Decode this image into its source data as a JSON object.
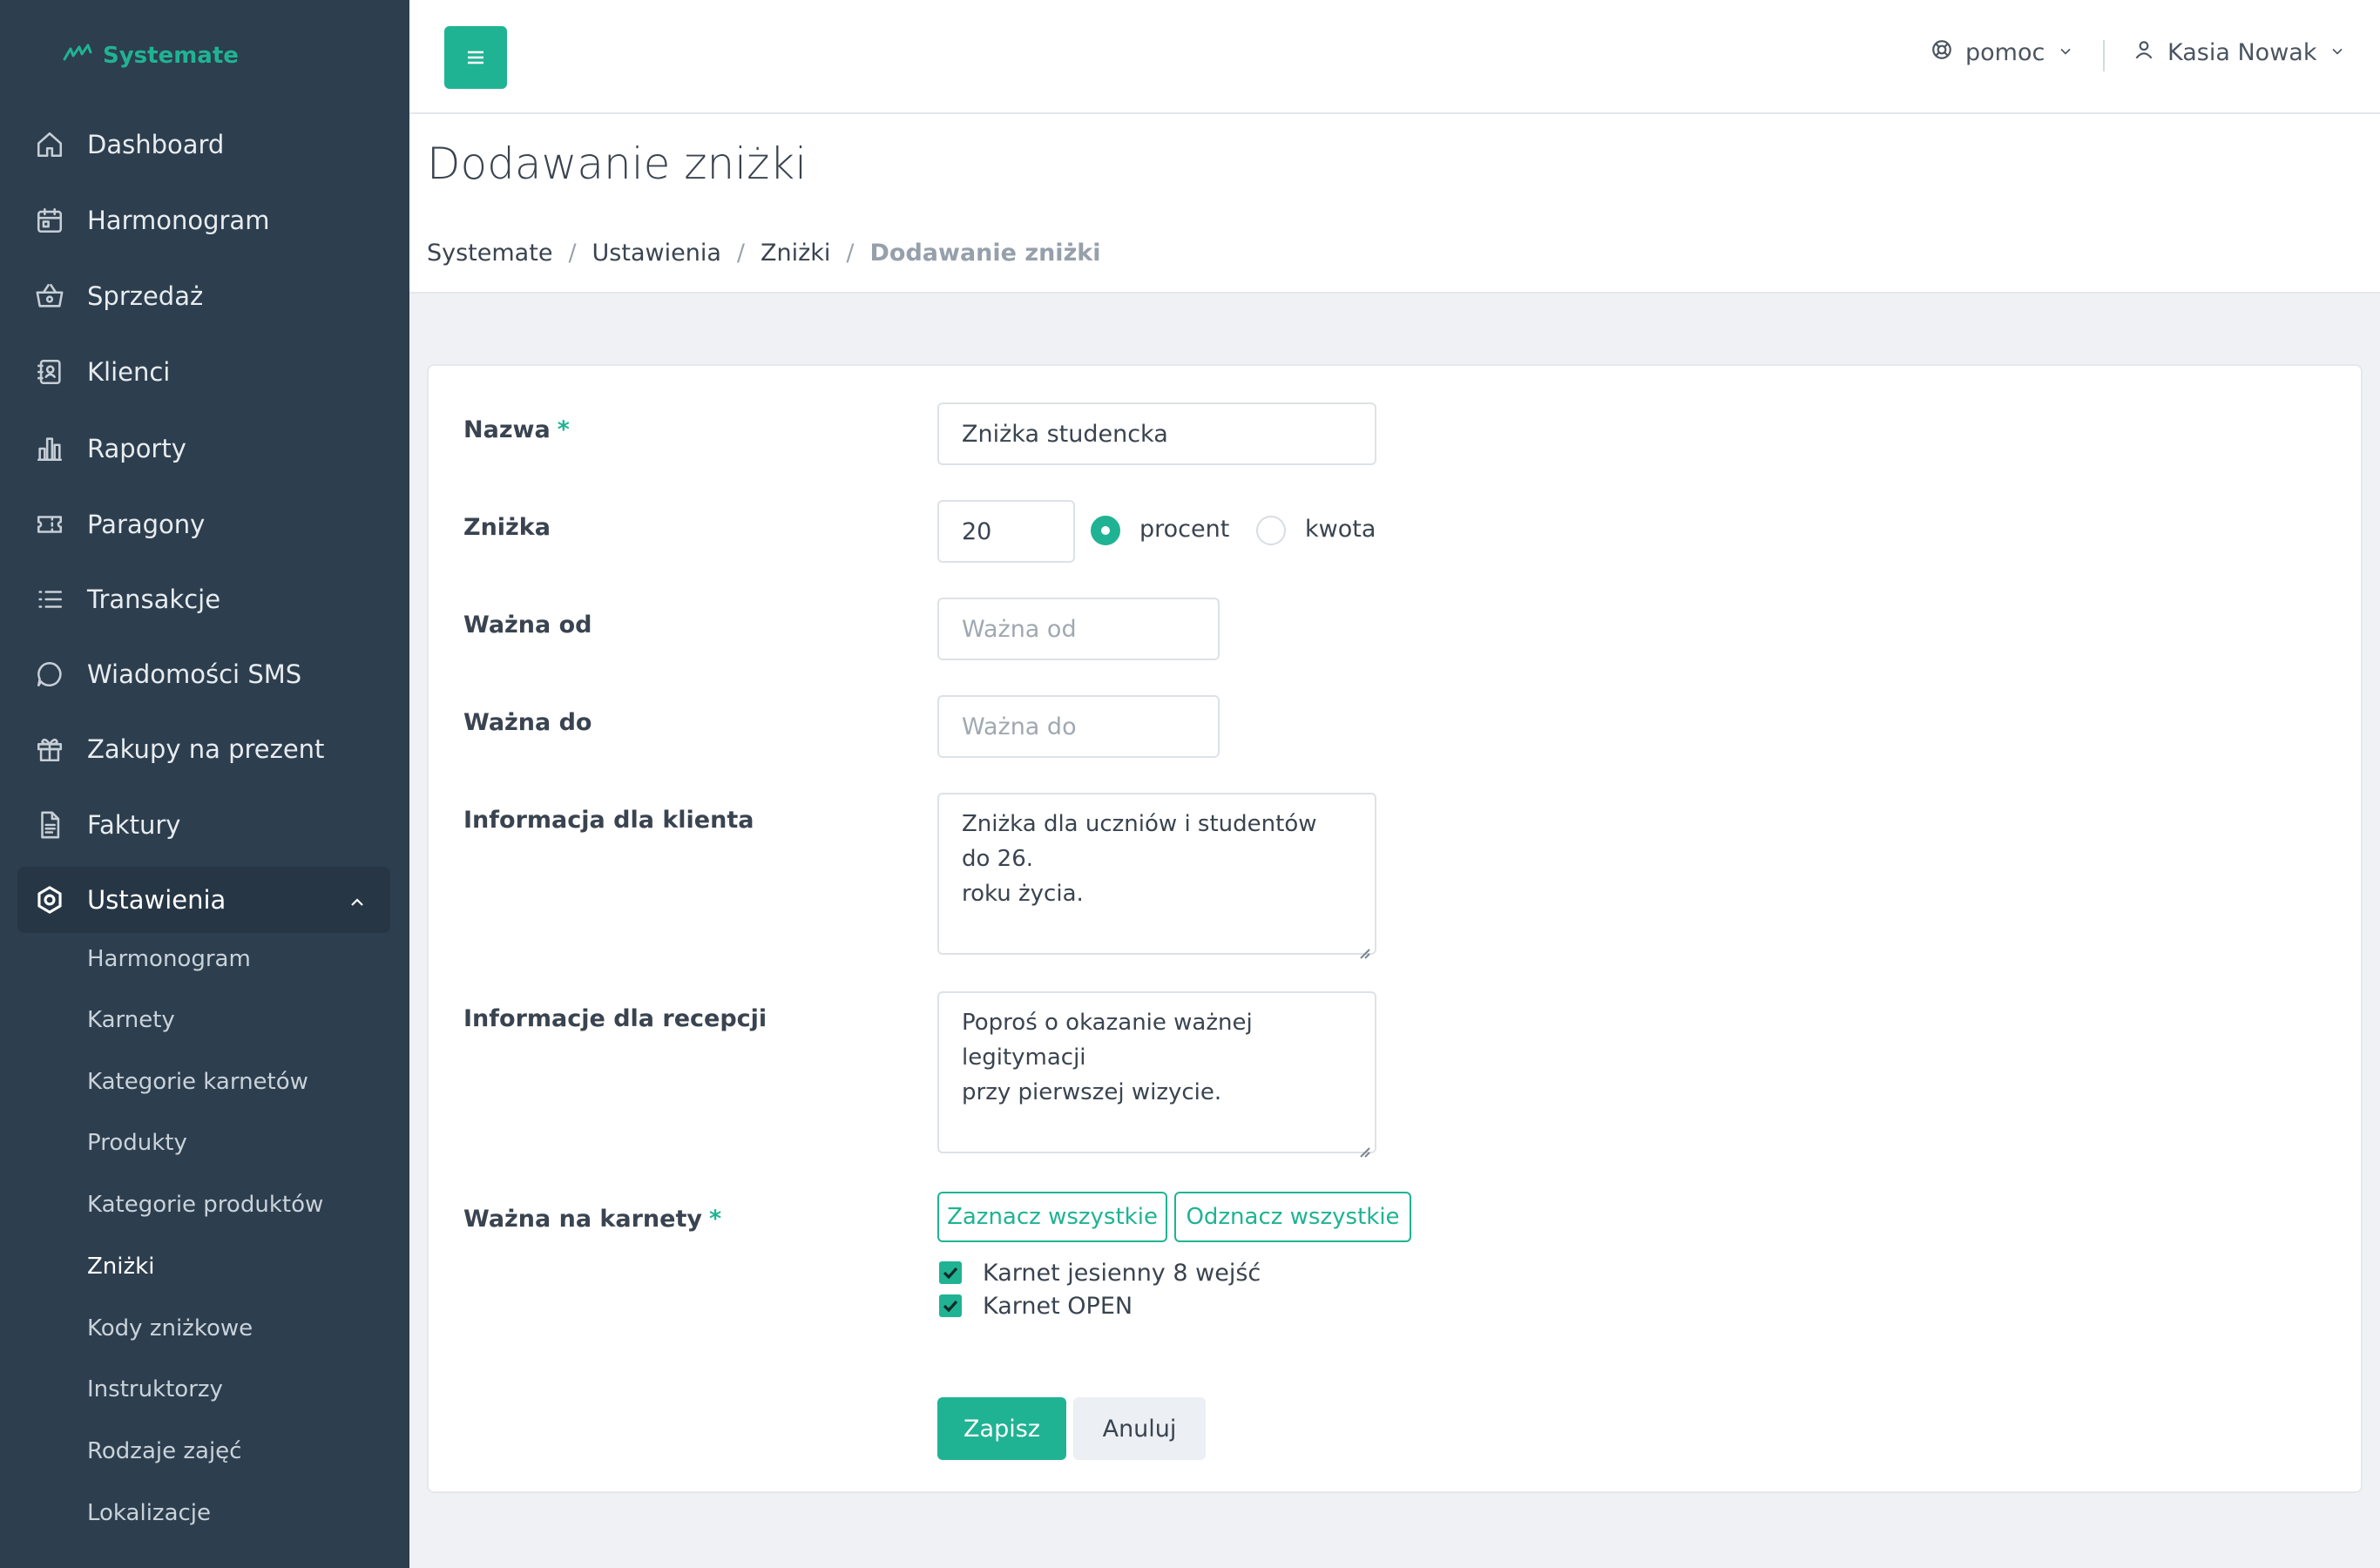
{
  "brand": {
    "name": "Systemate",
    "accent": "#20b393",
    "sidebar_bg": "#2d3e4e"
  },
  "sidebar": {
    "items": [
      {
        "label": "Dashboard",
        "icon": "home-icon"
      },
      {
        "label": "Harmonogram",
        "icon": "calendar-icon"
      },
      {
        "label": "Sprzedaż",
        "icon": "basket-icon"
      },
      {
        "label": "Klienci",
        "icon": "contacts-icon"
      },
      {
        "label": "Raporty",
        "icon": "bar-chart-icon"
      },
      {
        "label": "Paragony",
        "icon": "ticket-icon"
      },
      {
        "label": "Transakcje",
        "icon": "list-icon"
      },
      {
        "label": "Wiadomości SMS",
        "icon": "chat-icon"
      },
      {
        "label": "Zakupy na prezent",
        "icon": "gift-icon"
      },
      {
        "label": "Faktury",
        "icon": "document-icon"
      },
      {
        "label": "Ustawienia",
        "icon": "settings-icon",
        "expanded": true
      }
    ],
    "subitems": [
      {
        "label": "Harmonogram"
      },
      {
        "label": "Karnety"
      },
      {
        "label": "Kategorie karnetów"
      },
      {
        "label": "Produkty"
      },
      {
        "label": "Kategorie produktów"
      },
      {
        "label": "Zniżki",
        "current": true
      },
      {
        "label": "Kody zniżkowe"
      },
      {
        "label": "Instruktorzy"
      },
      {
        "label": "Rodzaje zajęć"
      },
      {
        "label": "Lokalizacje"
      }
    ]
  },
  "topbar": {
    "help_label": "pomoc",
    "user_name": "Kasia Nowak"
  },
  "page": {
    "title": "Dodawanie zniżki",
    "breadcrumb": [
      "Systemate",
      "Ustawienia",
      "Zniżki",
      "Dodawanie zniżki"
    ]
  },
  "form": {
    "name": {
      "label": "Nazwa",
      "required_mark": "*",
      "value": "Zniżka studencka"
    },
    "discount": {
      "label": "Zniżka",
      "value": "20",
      "options": [
        {
          "label": "procent",
          "selected": true
        },
        {
          "label": "kwota",
          "selected": false
        }
      ]
    },
    "valid_from": {
      "label": "Ważna od",
      "placeholder": "Ważna od"
    },
    "valid_to": {
      "label": "Ważna do",
      "placeholder": "Ważna do"
    },
    "client_info": {
      "label": "Informacja dla klienta",
      "lines": [
        "Zniżka dla uczniów i studentów do 26.",
        "roku życia."
      ]
    },
    "reception_info": {
      "label": "Informacje dla recepcji",
      "lines": [
        "Poproś o okazanie ważnej legitymacji",
        "przy pierwszej wizycie."
      ]
    },
    "passes": {
      "label": "Ważna na karnety",
      "required_mark": "*",
      "select_all": "Zaznacz wszystkie",
      "deselect_all": "Odznacz wszystkie",
      "items": [
        {
          "label": "Karnet jesienny 8 wejść",
          "checked": true
        },
        {
          "label": "Karnet OPEN",
          "checked": true
        }
      ]
    },
    "save_label": "Zapisz",
    "cancel_label": "Anuluj"
  }
}
